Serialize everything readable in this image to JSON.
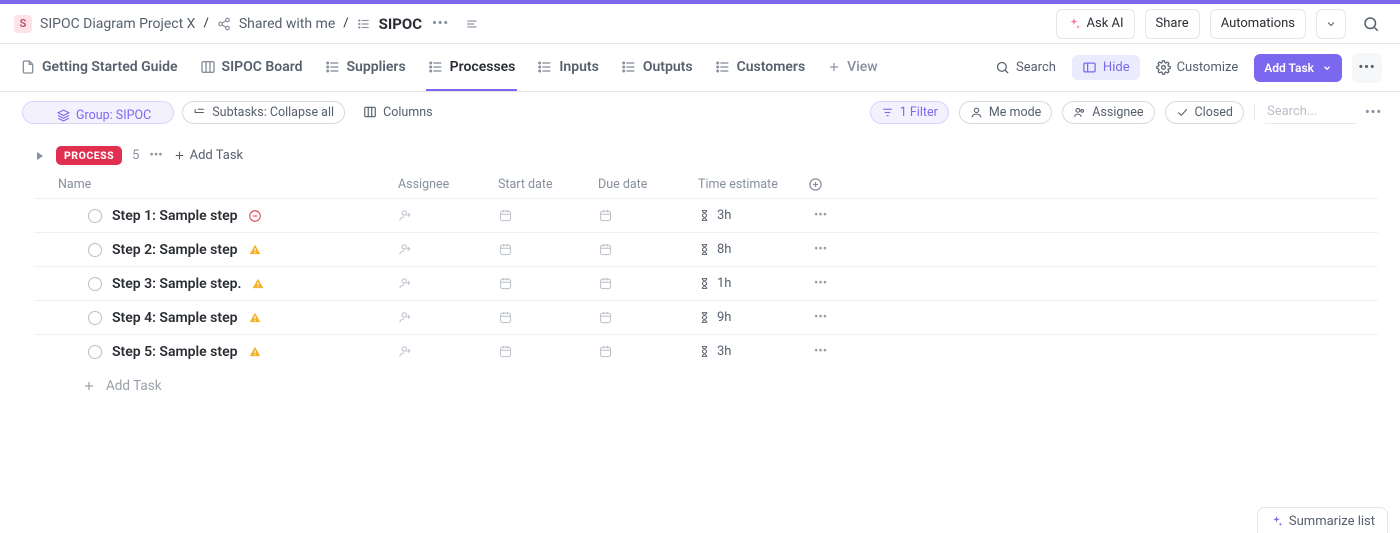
{
  "breadcrumbs": {
    "project_initial": "S",
    "project": "SIPOC Diagram Project X",
    "shared": "Shared with me",
    "current": "SIPOC"
  },
  "top_actions": {
    "ask_ai": "Ask AI",
    "share": "Share",
    "automations": "Automations"
  },
  "tabs": [
    {
      "label": "Getting Started Guide",
      "icon": "doc"
    },
    {
      "label": "SIPOC Board",
      "icon": "board"
    },
    {
      "label": "Suppliers",
      "icon": "list"
    },
    {
      "label": "Processes",
      "icon": "list",
      "active": true
    },
    {
      "label": "Inputs",
      "icon": "list"
    },
    {
      "label": "Outputs",
      "icon": "list"
    },
    {
      "label": "Customers",
      "icon": "list"
    }
  ],
  "tabs_add": "View",
  "tabs_right": {
    "search": "Search",
    "hide": "Hide",
    "customize": "Customize",
    "add_task": "Add Task"
  },
  "toolbar": {
    "group": "Group: SIPOC",
    "subtasks": "Subtasks: Collapse all",
    "columns": "Columns",
    "filter": "1 Filter",
    "me_mode": "Me mode",
    "assignee": "Assignee",
    "closed": "Closed",
    "search_placeholder": "Search..."
  },
  "group": {
    "name": "PROCESS",
    "count": "5",
    "add_task": "Add Task"
  },
  "columns": {
    "name": "Name",
    "assignee": "Assignee",
    "start": "Start date",
    "due": "Due date",
    "time": "Time estimate"
  },
  "rows": [
    {
      "name": "Step 1: Sample step",
      "priority": "urgent",
      "time": "3h"
    },
    {
      "name": "Step 2: Sample step",
      "priority": "high",
      "time": "8h"
    },
    {
      "name": "Step 3: Sample step.",
      "priority": "high",
      "time": "1h"
    },
    {
      "name": "Step 4: Sample step",
      "priority": "high",
      "time": "9h"
    },
    {
      "name": "Step 5: Sample step",
      "priority": "high",
      "time": "3h"
    }
  ],
  "add_row": "Add Task",
  "summarize": "Summarize list"
}
